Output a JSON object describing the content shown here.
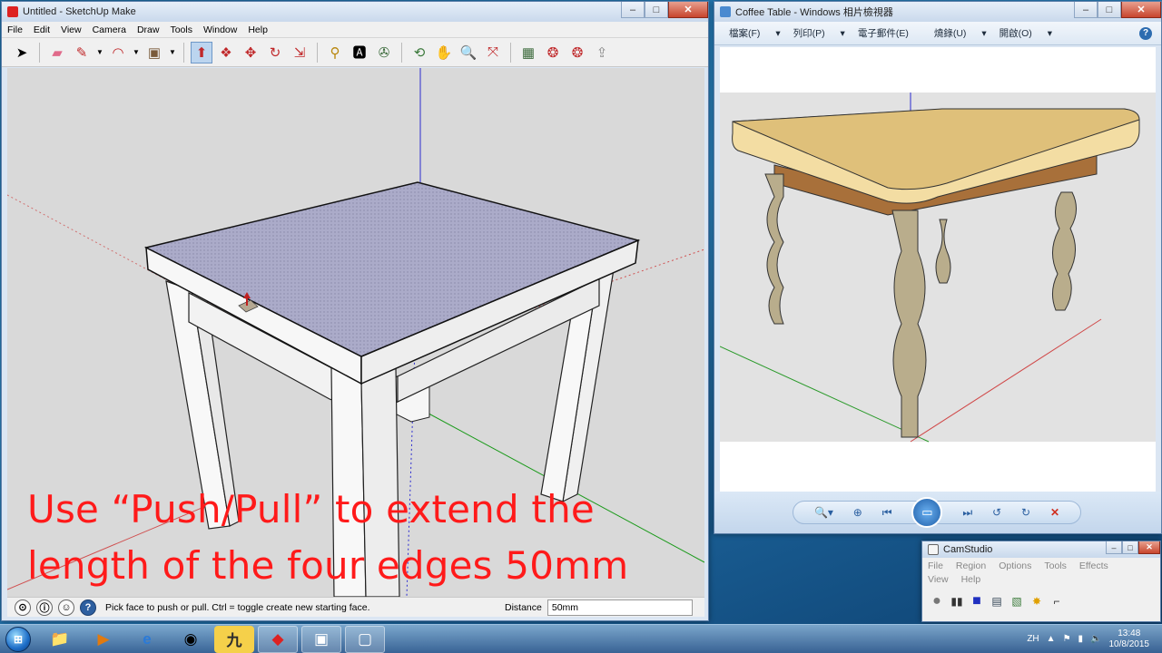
{
  "sketchup": {
    "title": "Untitled - SketchUp Make",
    "menu": [
      "File",
      "Edit",
      "View",
      "Camera",
      "Draw",
      "Tools",
      "Window",
      "Help"
    ],
    "caption_line1": "Use “Push/Pull” to extend the",
    "caption_line2": "length of the four edges 50mm",
    "status_text": "Pick face to push or pull.  Ctrl = toggle create new starting face.",
    "distance_label": "Distance",
    "distance_value": "50mm",
    "window_buttons": {
      "minimize": "–",
      "maximize": "□",
      "close": "✕"
    }
  },
  "photo_viewer": {
    "title": "Coffee Table - Windows 相片檢視器",
    "menu": [
      "檔案(F)",
      "列印(P)",
      "電子郵件(E)",
      "燒錄(U)",
      "開啟(O)"
    ],
    "help": "?"
  },
  "camstudio": {
    "title": "CamStudio",
    "menu": [
      "File",
      "Region",
      "Options",
      "Tools",
      "Effects",
      "View",
      "Help"
    ]
  },
  "taskbar": {
    "lang": "ZH",
    "time": "13:48",
    "date": "10/8/2015"
  },
  "colors": {
    "caption": "#ff1a1a",
    "viewport_bg": "#d9d9d9",
    "selected_face": "#a9a9c8",
    "table_top_wood": "#e4c487",
    "table_leg": "#b9ad8c"
  }
}
